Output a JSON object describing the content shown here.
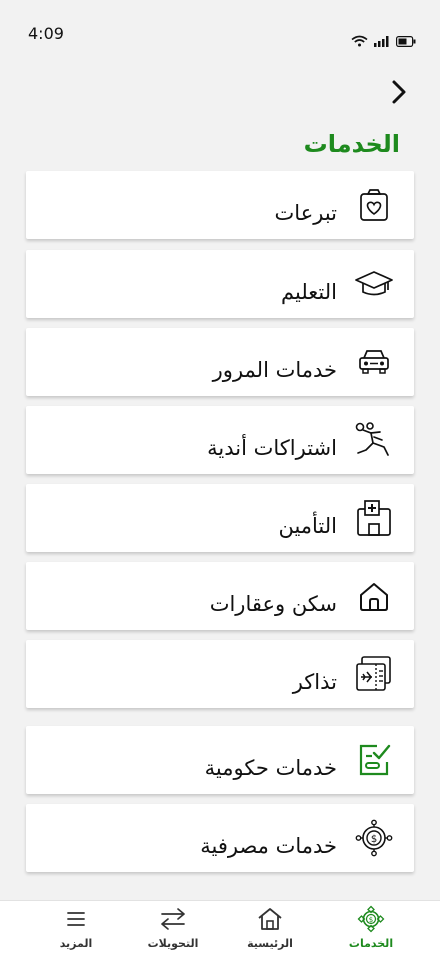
{
  "status": {
    "time": "4:09"
  },
  "header": {
    "title": "الخدمات",
    "back_icon": "chevron-right-icon"
  },
  "services": [
    {
      "label": "تبرعات",
      "icon": "donation-box-icon"
    },
    {
      "label": "التعليم",
      "icon": "graduation-cap-icon"
    },
    {
      "label": "خدمات المرور",
      "icon": "car-icon"
    },
    {
      "label": "اشتراكات أندية",
      "icon": "sports-player-icon"
    },
    {
      "label": "التأمين",
      "icon": "hospital-icon"
    },
    {
      "label": "سكن وعقارات",
      "icon": "home-icon"
    },
    {
      "label": "تذاكر",
      "icon": "tickets-icon"
    },
    {
      "label": "خدمات حكومية",
      "icon": "government-checklist-icon"
    },
    {
      "label": "خدمات مصرفية",
      "icon": "banking-coin-icon"
    }
  ],
  "bottom_nav": [
    {
      "label": "الخدمات",
      "icon": "services-coin-icon",
      "active": true
    },
    {
      "label": "الرئيسية",
      "icon": "home-icon",
      "active": false
    },
    {
      "label": "التحويلات",
      "icon": "transfer-arrows-icon",
      "active": false
    },
    {
      "label": "المزيد",
      "icon": "menu-icon",
      "active": false
    }
  ],
  "colors": {
    "accent": "#1e8a1e",
    "background": "#f2f2f2",
    "card": "#ffffff",
    "text": "#111111"
  }
}
